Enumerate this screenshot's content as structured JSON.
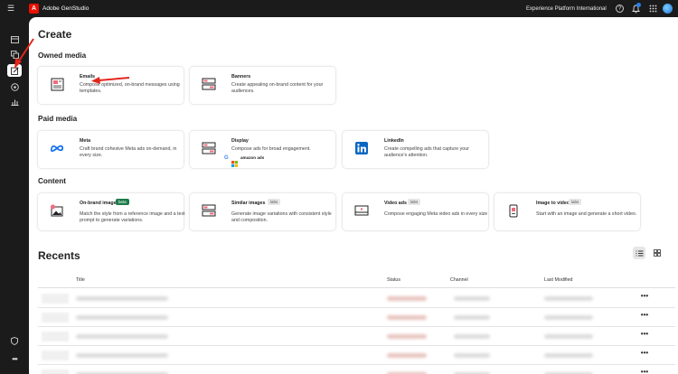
{
  "topbar": {
    "app_name": "Adobe GenStudio",
    "logo_letter": "A",
    "org_name": "Experience Platform International",
    "help_label": "?",
    "menu_icon": "hamburger-icon",
    "bell_icon": "bell-icon",
    "apps_icon": "app-grid-icon",
    "accent": "#eb1000"
  },
  "main": {
    "title": "Create",
    "sections": {
      "owned": {
        "heading": "Owned media",
        "cards": [
          {
            "title": "Emails",
            "desc": "Compose optimized, on-brand messages using templates."
          },
          {
            "title": "Banners",
            "desc": "Create appealing on-brand content for your audiences."
          }
        ]
      },
      "paid": {
        "heading": "Paid media",
        "cards": [
          {
            "title": "Meta",
            "desc": "Craft brand cohesive Meta ads on-demand, in every size."
          },
          {
            "title": "Display",
            "desc": "Compose ads for broad engagement.",
            "logos_text": "amazon ads"
          },
          {
            "title": "LinkedIn",
            "desc": "Create compelling ads that capture your audience's attention."
          }
        ]
      },
      "content": {
        "heading": "Content",
        "cards": [
          {
            "title": "On-brand images",
            "badge": "beta",
            "desc": "Match the style from a reference image and a text prompt to generate variations."
          },
          {
            "title": "Similar images",
            "badge": "labs",
            "desc": "Generate image variations with consistent style and composition."
          },
          {
            "title": "Video ads",
            "badge": "labs",
            "desc": "Compose engaging Meta video ads in every size"
          },
          {
            "title": "Image to video",
            "badge": "labs",
            "desc": "Start with an image and generate a short video."
          }
        ]
      }
    },
    "recents": {
      "heading": "Recents",
      "columns": [
        "Title",
        "Status",
        "Channel",
        "Last Modified"
      ],
      "more_label": "•••"
    }
  }
}
